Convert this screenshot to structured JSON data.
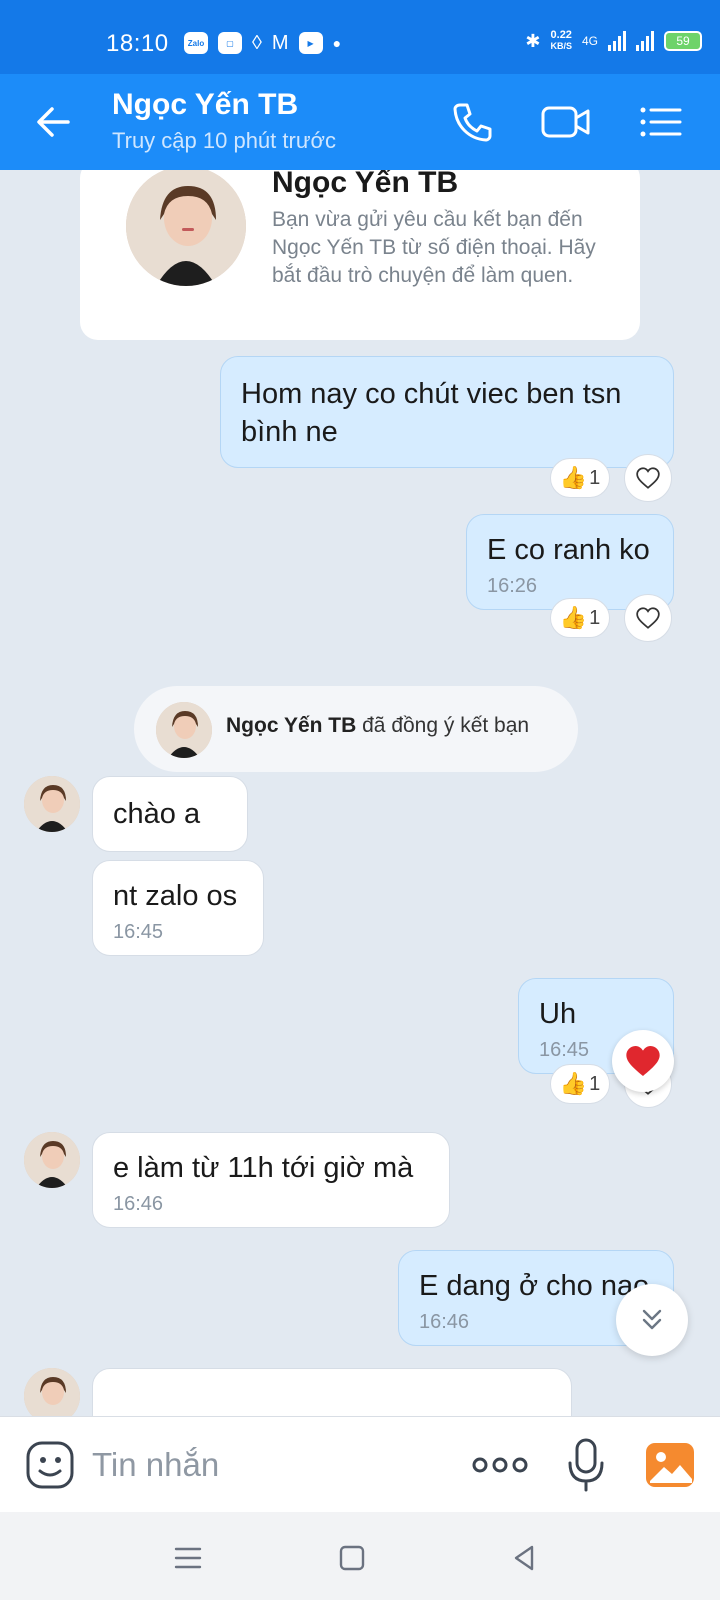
{
  "status_bar": {
    "time": "18:10",
    "app_icons": [
      "Zalo",
      "chat-bubble",
      "vpn-diamond",
      "gmail",
      "youtube",
      "dot"
    ],
    "zalo_label": "Zalo",
    "net_speed": "0.22",
    "net_unit": "KB/S",
    "network_type": "4G",
    "battery": "59"
  },
  "header": {
    "contact_name": "Ngọc Yến TB",
    "last_seen": "Truy cập 10 phút trước",
    "icons": [
      "back-arrow-icon",
      "phone-icon",
      "video-call-icon",
      "menu-list-icon"
    ]
  },
  "intro_card": {
    "name": "Ngọc Yến TB",
    "text": "Bạn vừa gửi yêu cầu kết bạn đến Ngọc Yến TB từ số điện thoại. Hãy bắt đầu trò chuyện để làm quen."
  },
  "messages": [
    {
      "id": "m1",
      "direction": "out",
      "text": "Hom nay co chút viec ben tsn bình ne",
      "time": "",
      "reaction_count": "1"
    },
    {
      "id": "m2",
      "direction": "out",
      "text": "E co ranh ko",
      "time": "16:26",
      "reaction_count": "1"
    },
    {
      "id": "m3",
      "direction": "in",
      "text": "chào a",
      "time": ""
    },
    {
      "id": "m4",
      "direction": "in",
      "text": "nt zalo os",
      "time": "16:45"
    },
    {
      "id": "m5",
      "direction": "out",
      "text": "Uh",
      "time": "16:45",
      "reaction_count": "1"
    },
    {
      "id": "m6",
      "direction": "in",
      "text": "e làm từ 11h tới giờ mà",
      "time": "16:46"
    },
    {
      "id": "m7",
      "direction": "out",
      "text": "E dang ở cho nao",
      "time": "16:46"
    }
  ],
  "friend_notice": {
    "name": "Ngọc Yến TB",
    "text": " đã đồng ý kết bạn"
  },
  "input_bar": {
    "placeholder": "Tin nhắn",
    "icons": [
      "emoji-icon",
      "more-dots-icon",
      "microphone-icon",
      "gallery-icon"
    ]
  },
  "colors": {
    "status_bar": "#1479e8",
    "header": "#1c8cf9",
    "chat_background": "#e2e9f1",
    "outgoing_bubble": "#d6ecff",
    "incoming_bubble": "#ffffff",
    "heart_reaction": "#e0272e",
    "gallery_accent": "#f58a2f"
  }
}
